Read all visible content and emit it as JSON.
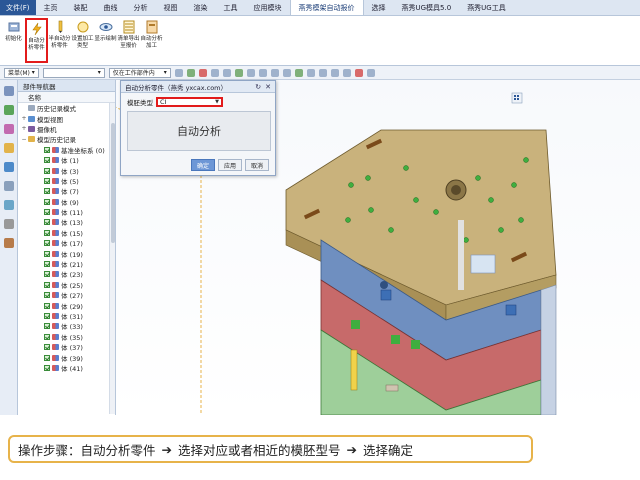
{
  "menubar": {
    "tabs": [
      "文件(F)",
      "主页",
      "装配",
      "曲线",
      "分析",
      "视图",
      "渲染",
      "工具",
      "应用模块",
      "燕秀模架自动报价",
      "选择",
      "燕秀UG模具5.0",
      "燕秀UG工具"
    ]
  },
  "ribbon": {
    "buttons": [
      {
        "label": "初始化",
        "icon": "init-icon"
      },
      {
        "label": "自动分析零件",
        "icon": "lightning-icon"
      },
      {
        "label": "半自动分析零件",
        "icon": "pencil-icon"
      },
      {
        "label": "设置加工类型",
        "icon": "circle-icon"
      },
      {
        "label": "显示绘制",
        "icon": "eye-icon"
      },
      {
        "label": "清单导出至报价",
        "icon": "table-icon"
      },
      {
        "label": "自动分析加工",
        "icon": "doc-icon"
      }
    ]
  },
  "cmdbar": {
    "menu": "菜单(M)",
    "filter_placeholder": "",
    "assembly": "仅在工作部件内"
  },
  "navigator": {
    "title": "部件导航器",
    "column": "名称",
    "items": [
      {
        "label": "历史记录模式",
        "kind": "clock"
      },
      {
        "label": "模型视图",
        "kind": "view",
        "exp": "+"
      },
      {
        "label": "摄像机",
        "kind": "cam",
        "exp": "+"
      },
      {
        "label": "模型历史记录",
        "kind": "folder",
        "exp": "−"
      },
      {
        "label": "基准坐标系 (0)",
        "kind": "check"
      },
      {
        "label": "体 (1)",
        "kind": "check"
      },
      {
        "label": "体 (3)",
        "kind": "check"
      },
      {
        "label": "体 (5)",
        "kind": "check"
      },
      {
        "label": "体 (7)",
        "kind": "check"
      },
      {
        "label": "体 (9)",
        "kind": "check"
      },
      {
        "label": "体 (11)",
        "kind": "check"
      },
      {
        "label": "体 (13)",
        "kind": "check"
      },
      {
        "label": "体 (15)",
        "kind": "check"
      },
      {
        "label": "体 (17)",
        "kind": "check"
      },
      {
        "label": "体 (19)",
        "kind": "check"
      },
      {
        "label": "体 (21)",
        "kind": "check"
      },
      {
        "label": "体 (23)",
        "kind": "check"
      },
      {
        "label": "体 (25)",
        "kind": "check"
      },
      {
        "label": "体 (27)",
        "kind": "check"
      },
      {
        "label": "体 (29)",
        "kind": "check"
      },
      {
        "label": "体 (31)",
        "kind": "check"
      },
      {
        "label": "体 (33)",
        "kind": "check"
      },
      {
        "label": "体 (35)",
        "kind": "check"
      },
      {
        "label": "体 (37)",
        "kind": "check"
      },
      {
        "label": "体 (39)",
        "kind": "check"
      },
      {
        "label": "体 (41)",
        "kind": "check"
      }
    ]
  },
  "dialog": {
    "title": "自动分析零件（燕秀 yxcax.com）",
    "type_label": "模胚类型",
    "type_value": "CI",
    "main_button": "自动分析",
    "ok": "确定",
    "apply": "应用",
    "cancel": "取消"
  },
  "instruction": {
    "prefix": "操作步骤：",
    "step1": "自动分析零件",
    "arrow": "➔",
    "step2": "选择对应或者相近的模胚型号",
    "step3": "选择确定"
  },
  "colors": {
    "highlight": "#e21b1b",
    "instruction_border": "#e7b34a",
    "plate_tan": "#c9b27c",
    "plate_blue": "#6f8fc0",
    "plate_red": "#c76a6a",
    "plate_green": "#9ecf9a"
  }
}
